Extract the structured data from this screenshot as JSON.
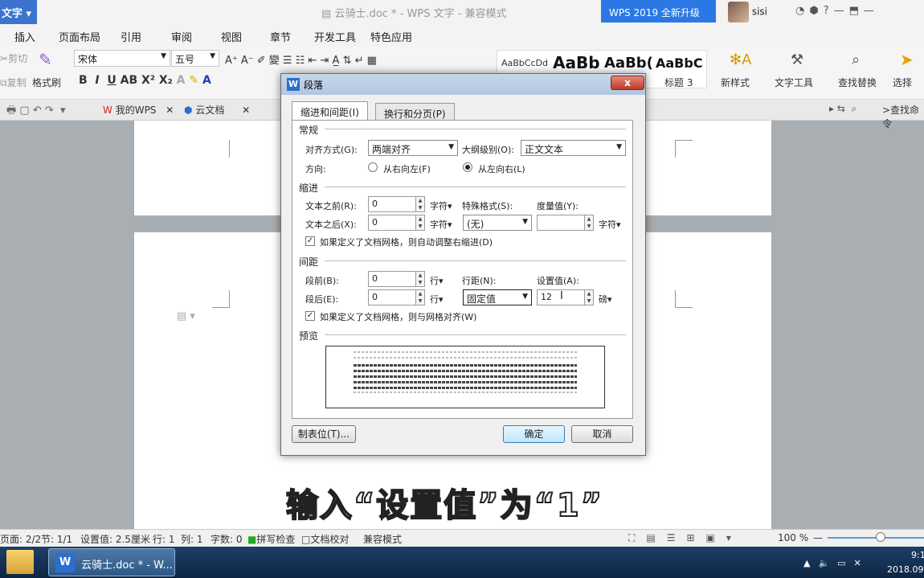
{
  "app": {
    "menu_button": "文字",
    "window_title": "云骑士.doc * - WPS 文字 - 兼容模式",
    "upgrade": "WPS 2019 全新升级",
    "user": "sisi"
  },
  "menu": [
    "插入",
    "页面布局",
    "引用",
    "审阅",
    "视图",
    "章节",
    "开发工具",
    "特色应用"
  ],
  "ribbon": {
    "cut": "剪切",
    "copy": "复制",
    "format_painter": "格式刷",
    "font": "宋体",
    "size": "五号",
    "style_samples": [
      "AaBbCcDd",
      "AaBb",
      "AaBb(",
      "AaBbC"
    ],
    "heading3": "标题 3",
    "new_style": "新样式",
    "text_tools": "文字工具",
    "find_replace": "查找替换",
    "select": "选择",
    "find_command": ">查找命令"
  },
  "tabs": [
    "我的WPS",
    "云文档"
  ],
  "dialog": {
    "title": "段落",
    "close": "x",
    "tab_indent": "缩进和间距(I)",
    "tab_pagination": "换行和分页(P)",
    "general": "常规",
    "alignment_label": "对齐方式(G):",
    "alignment_value": "两端对齐",
    "outline_label": "大纲级别(O):",
    "outline_value": "正文文本",
    "direction_label": "方向:",
    "rtl": "从右向左(F)",
    "ltr": "从左向右(L)",
    "indent": "缩进",
    "before_text_label": "文本之前(R):",
    "before_text_value": "0",
    "unit_char": "字符",
    "special_label": "特殊格式(S):",
    "measure_label": "度量值(Y):",
    "after_text_label": "文本之后(X):",
    "after_text_value": "0",
    "special_value": "(无)",
    "grid_indent": "如果定义了文档网格，则自动调整右缩进(D)",
    "spacing": "间距",
    "before_label": "段前(B):",
    "before_value": "0",
    "unit_line": "行",
    "line_spacing_label": "行距(N):",
    "setting_label": "设置值(A):",
    "after_label": "段后(E):",
    "after_value": "0",
    "line_spacing_value": "固定值",
    "setting_value": "12",
    "unit_pt": "磅",
    "grid_align": "如果定义了文档网格，则与网格对齐(W)",
    "preview": "预览",
    "tabs_button": "制表位(T)...",
    "ok": "确定",
    "cancel": "取消"
  },
  "subtitle": "输入“设置值”为“1”",
  "status": {
    "page": "页面: 2/2",
    "section": "节: 1/1",
    "setting": "设置值: 2.5厘米",
    "row": "行: 1",
    "col": "列: 1",
    "words": "字数: 0",
    "spell": "拼写检查",
    "proof": "文档校对",
    "compat": "兼容模式",
    "zoom": "100 %"
  },
  "taskbar": {
    "item": "云骑士.doc * - W...",
    "time": "9:1",
    "date": "2018.09"
  }
}
